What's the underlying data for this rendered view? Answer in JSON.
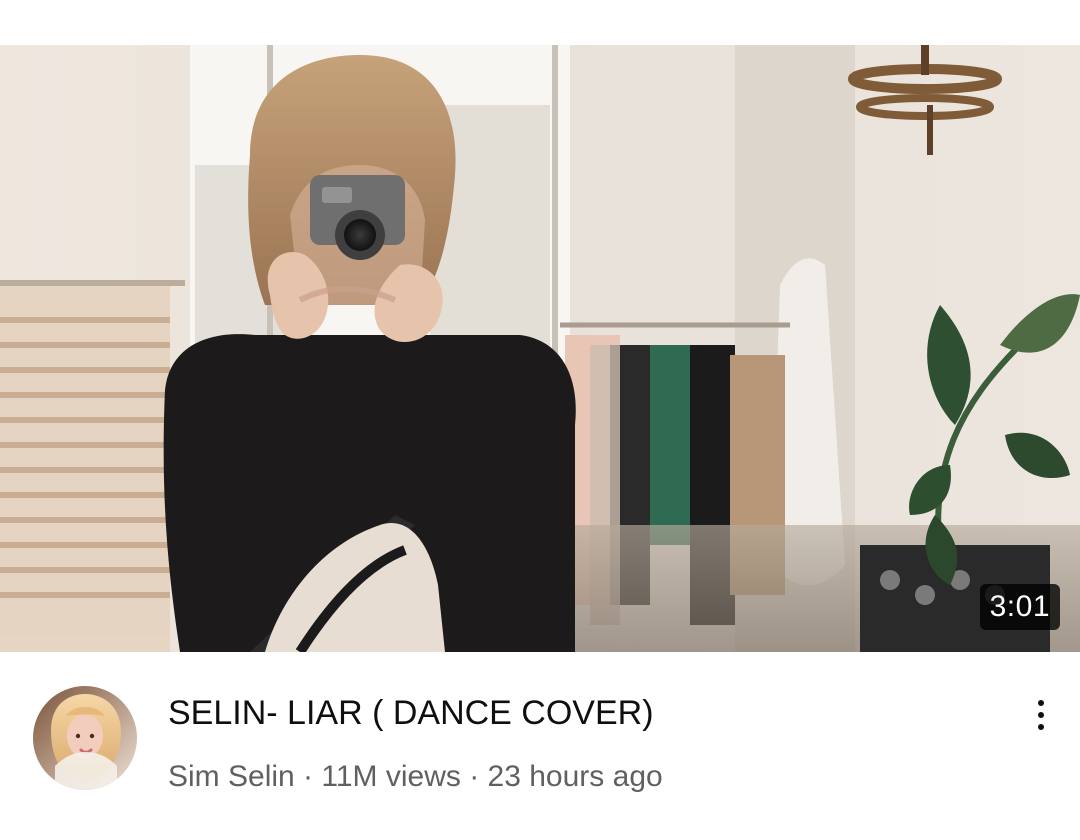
{
  "video": {
    "duration": "3:01",
    "title": "SELIN- LIAR ( DANCE COVER)",
    "channel": "Sim Selin",
    "separator": " · ",
    "views": "11M views",
    "age": "23 hours ago"
  },
  "icons": {
    "more": "more-vert-icon"
  },
  "colors": {
    "title": "#0f0f0f",
    "meta": "#606060",
    "duration_bg": "#000000"
  }
}
